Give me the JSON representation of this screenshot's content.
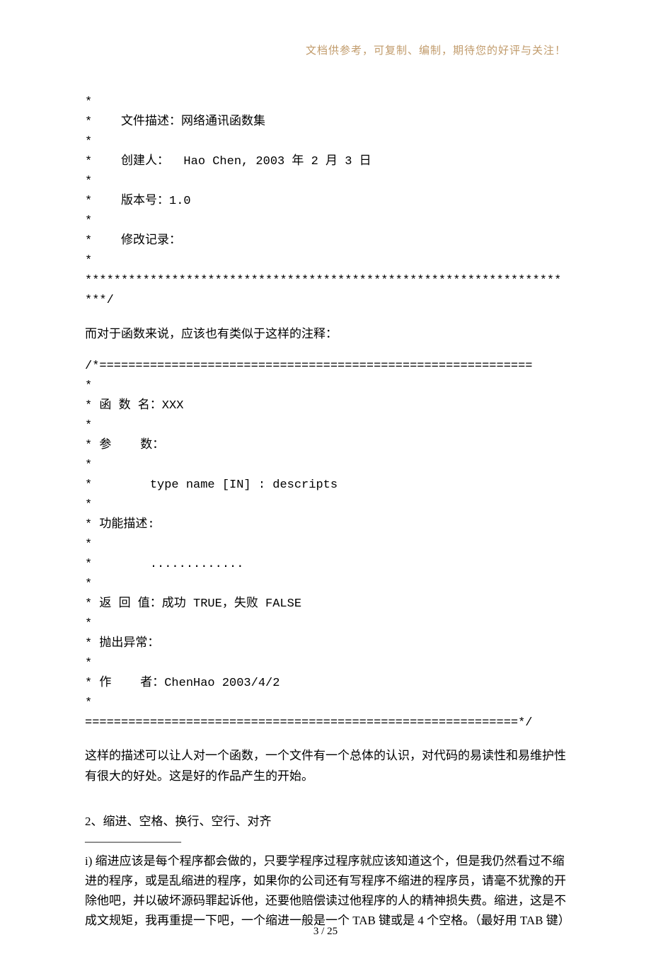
{
  "header_note": "文档供参考，可复制、编制，期待您的好评与关注！",
  "file_header": {
    "l1": "*",
    "l2": "*    文件描述：网络通讯函数集",
    "l3": "*",
    "l4": "*    创建人：  Hao Chen, 2003 年 2 月 3 日",
    "l5": "*",
    "l6": "*    版本号：1.0",
    "l7": "*",
    "l8": "*    修改记录：",
    "l9": "*",
    "l10": "*********************************************************************/",
    "l11": ""
  },
  "func_intro": "而对于函数来说，应该也有类似于这样的注释：",
  "func_header": {
    "l1": "/*============================================================",
    "l2": "*",
    "l3": "* 函 数 名：XXX",
    "l4": "*",
    "l5": "* 参    数：",
    "l6": "*",
    "l7": "*        type name [IN] : descripts",
    "l8": "*",
    "l9": "* 功能描述:",
    "l10": "*",
    "l11": "*        .............",
    "l12": "*",
    "l13": "* 返 回 值：成功 TRUE，失败 FALSE",
    "l14": "*",
    "l15": "* 抛出异常：",
    "l16": "*",
    "l17": "* 作    者：ChenHao 2003/4/2",
    "l18": "*",
    "l19": "============================================================*/"
  },
  "desc_para": "这样的描述可以让人对一个函数，一个文件有一个总体的认识，对代码的易读性和易维护性有很大的好处。这是好的作品产生的开始。",
  "section2": {
    "title": "2、缩进、空格、换行、空行、对齐",
    "divider": "————————",
    "body": "i) 缩进应该是每个程序都会做的，只要学程序过程序就应该知道这个，但是我仍然看过不缩进的程序，或是乱缩进的程序，如果你的公司还有写程序不缩进的程序员，请毫不犹豫的开除他吧，并以破坏源码罪起诉他，还要他赔偿读过他程序的人的精神损失费。缩进，这是不成文规矩，我再重提一下吧，一个缩进一般是一个 TAB 键或是 4 个空格。（最好用 TAB 键）"
  },
  "page_number": "3 / 25"
}
